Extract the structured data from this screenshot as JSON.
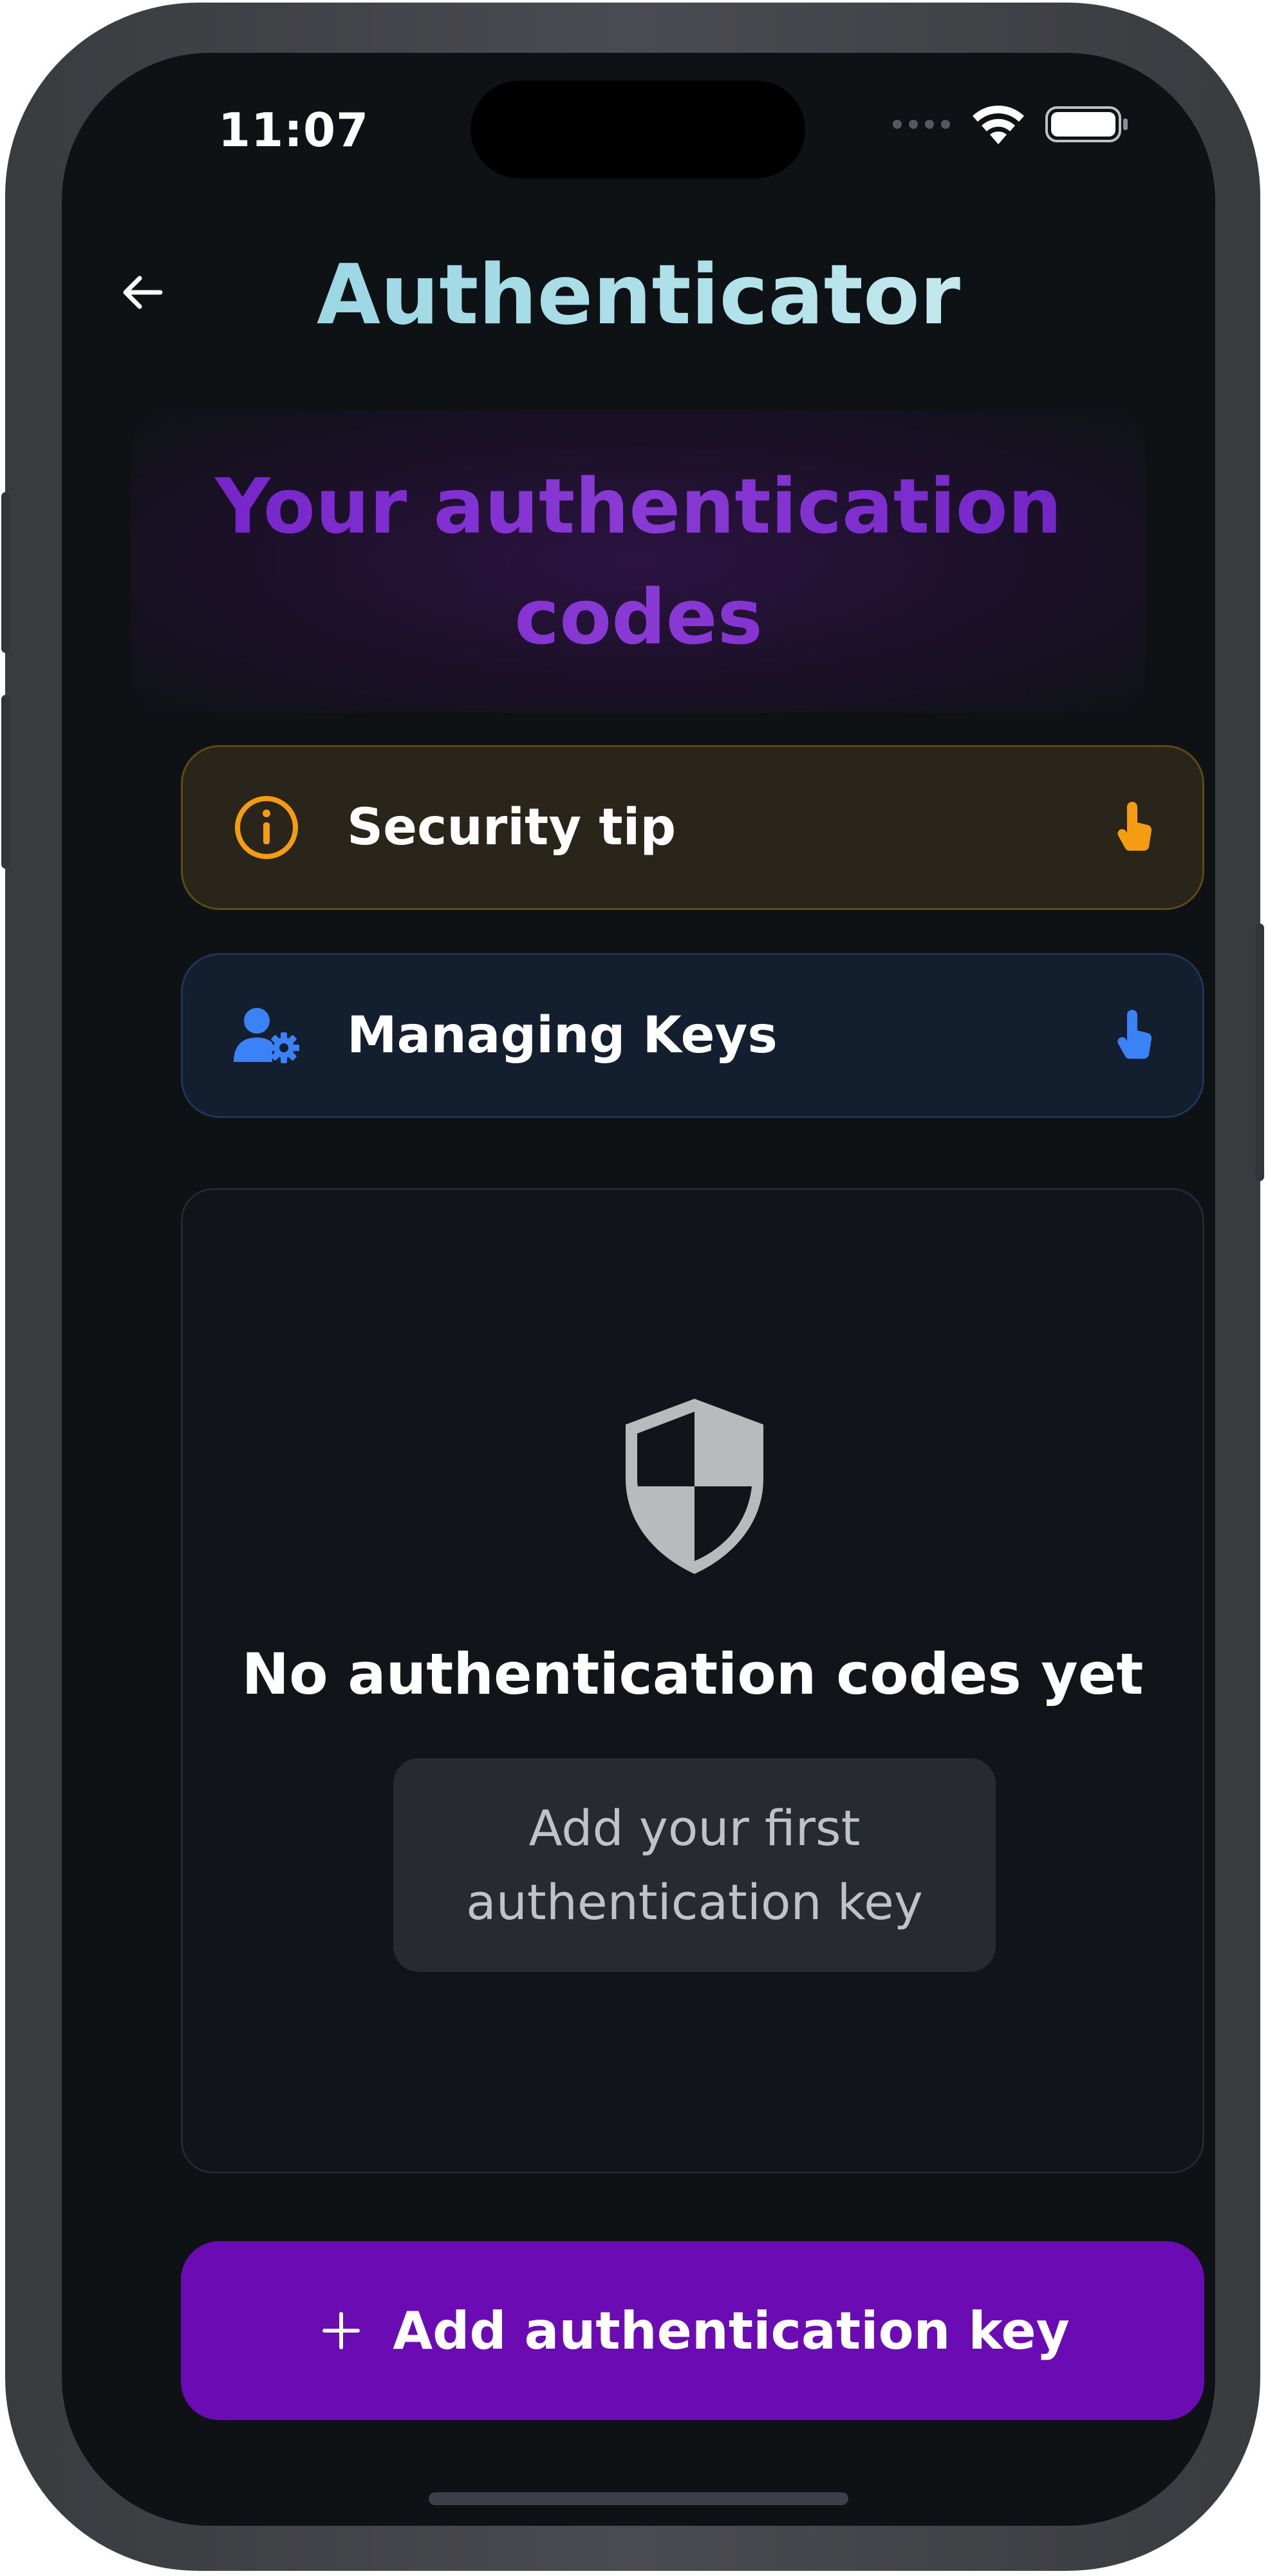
{
  "status_bar": {
    "time": "11:07"
  },
  "header": {
    "title": "Authenticator",
    "back_icon": "arrow-left-icon"
  },
  "hero": {
    "text": "Your authentication codes"
  },
  "cards": {
    "security_tip": {
      "label": "Security tip",
      "icon": "info-circle-icon",
      "action_icon": "tap-hand-icon",
      "accent": "#f49c12"
    },
    "managing_keys": {
      "label": "Managing Keys",
      "icon": "user-gear-icon",
      "action_icon": "tap-hand-icon",
      "accent": "#3b82f6"
    }
  },
  "empty_state": {
    "icon": "shield-icon",
    "title": "No authentication codes yet",
    "button_label": "Add your first authentication key"
  },
  "primary_action": {
    "label": "Add authentication key",
    "icon": "plus-icon",
    "color": "#6a0bb4"
  },
  "colors": {
    "background": "#0f1215",
    "title_gradient": "#9fd6e4",
    "hero_text": "#7e2ccf"
  }
}
